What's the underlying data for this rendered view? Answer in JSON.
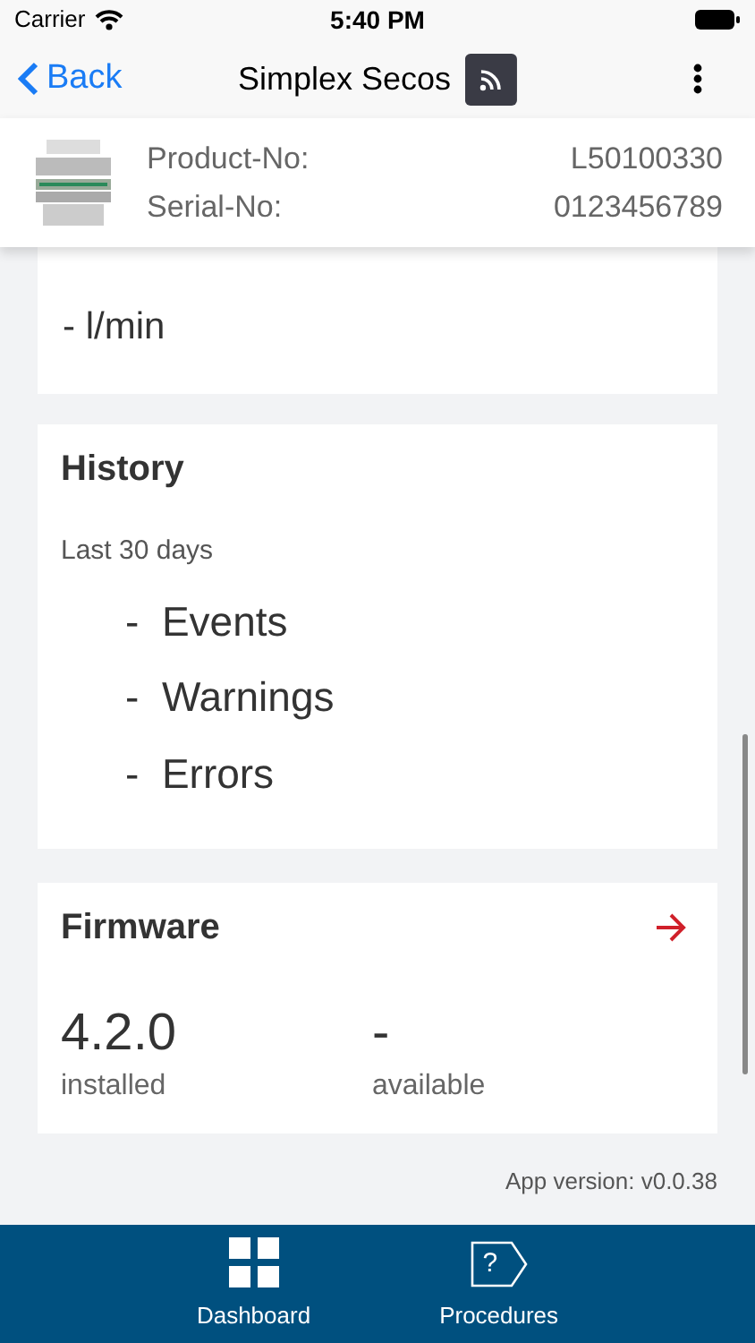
{
  "status_bar": {
    "carrier": "Carrier",
    "time": "5:40 PM"
  },
  "nav": {
    "back": "Back",
    "title": "Simplex Secos"
  },
  "product": {
    "fields": [
      {
        "label": "Product-No:",
        "value": "L50100330"
      },
      {
        "label": "Serial-No:",
        "value": "0123456789"
      }
    ]
  },
  "flow": {
    "value": "- l/min"
  },
  "history": {
    "title": "History",
    "subtitle": "Last 30 days",
    "items": [
      "-  Events",
      "-  Warnings",
      "-  Errors"
    ]
  },
  "firmware": {
    "title": "Firmware",
    "installed": {
      "value": "4.2.0",
      "label": "installed"
    },
    "available": {
      "value": "-",
      "label": "available"
    }
  },
  "app_version": "App version: v0.0.38",
  "tabs": [
    {
      "label": "Dashboard",
      "kind": "grid",
      "selected": false
    },
    {
      "label": "Procedures",
      "kind": "tag",
      "glyph": "?",
      "selected": false
    }
  ]
}
